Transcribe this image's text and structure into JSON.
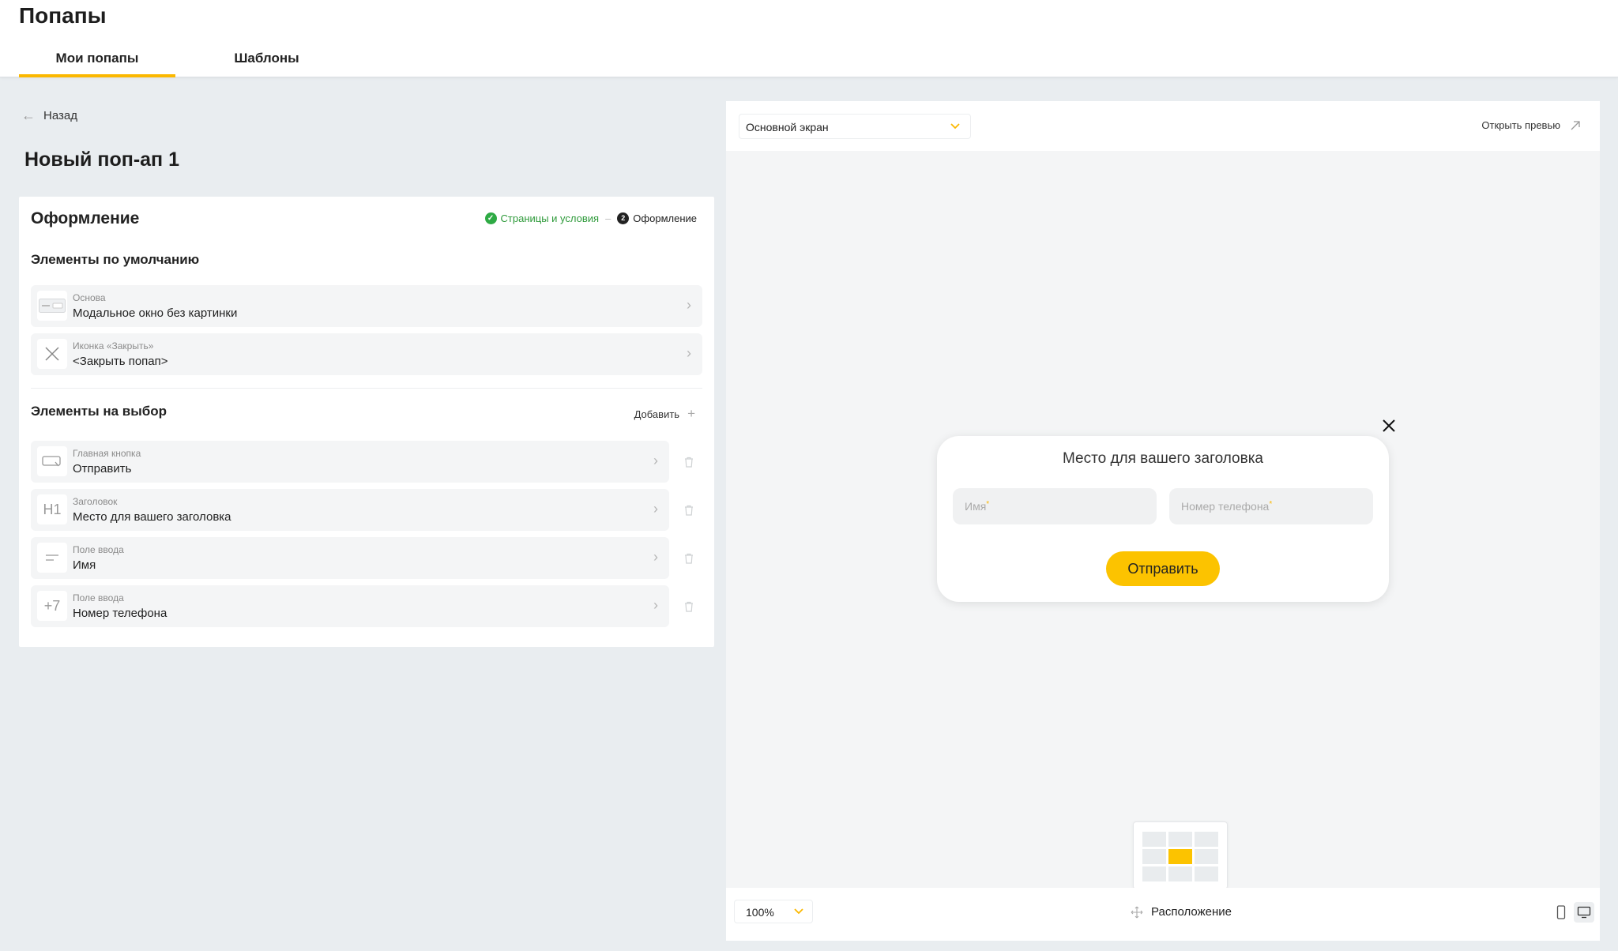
{
  "header": {
    "app_title": "Попапы",
    "tabs": [
      {
        "label": "Мои попапы",
        "active": true
      },
      {
        "label": "Шаблоны",
        "active": false
      }
    ]
  },
  "editor": {
    "back_label": "Назад",
    "title": "Новый поп-ап 1",
    "panel_title": "Оформление",
    "steps": {
      "done_label": "Страницы и условия",
      "current_number": "2",
      "current_label": "Оформление"
    },
    "default_section_title": "Элементы по умолчанию",
    "default_items": [
      {
        "label": "Основа",
        "value": "Модальное окно без картинки",
        "icon": "modal-icon"
      },
      {
        "label": "Иконка «Закрыть»",
        "value": "<Закрыть попап>",
        "icon": "close-icon"
      }
    ],
    "optional_section_title": "Элементы на выбор",
    "add_label": "Добавить",
    "optional_items": [
      {
        "label": "Главная кнопка",
        "value": "Отправить",
        "icon": "button-icon"
      },
      {
        "label": "Заголовок",
        "value": "Место для вашего заголовка",
        "icon": "heading-icon",
        "icon_text": "H1"
      },
      {
        "label": "Поле ввода",
        "value": "Имя",
        "icon": "text-field-icon"
      },
      {
        "label": "Поле ввода",
        "value": "Номер телефона",
        "icon": "phone-field-icon",
        "icon_text": "+7"
      }
    ]
  },
  "preview": {
    "screen_select": "Основной экран",
    "open_preview_label": "Открыть превью",
    "popup": {
      "title": "Место для вашего заголовка",
      "name_placeholder": "Имя",
      "phone_placeholder": "Номер телефона",
      "required_mark": "*",
      "submit_label": "Отправить"
    },
    "zoom": "100%",
    "placement_label": "Расположение",
    "placement_selected": "center",
    "active_device": "desktop"
  },
  "colors": {
    "accent": "#fcc300",
    "tab_underline": "#fbb800",
    "success": "#2eaa44",
    "background": "#e9edf0"
  }
}
